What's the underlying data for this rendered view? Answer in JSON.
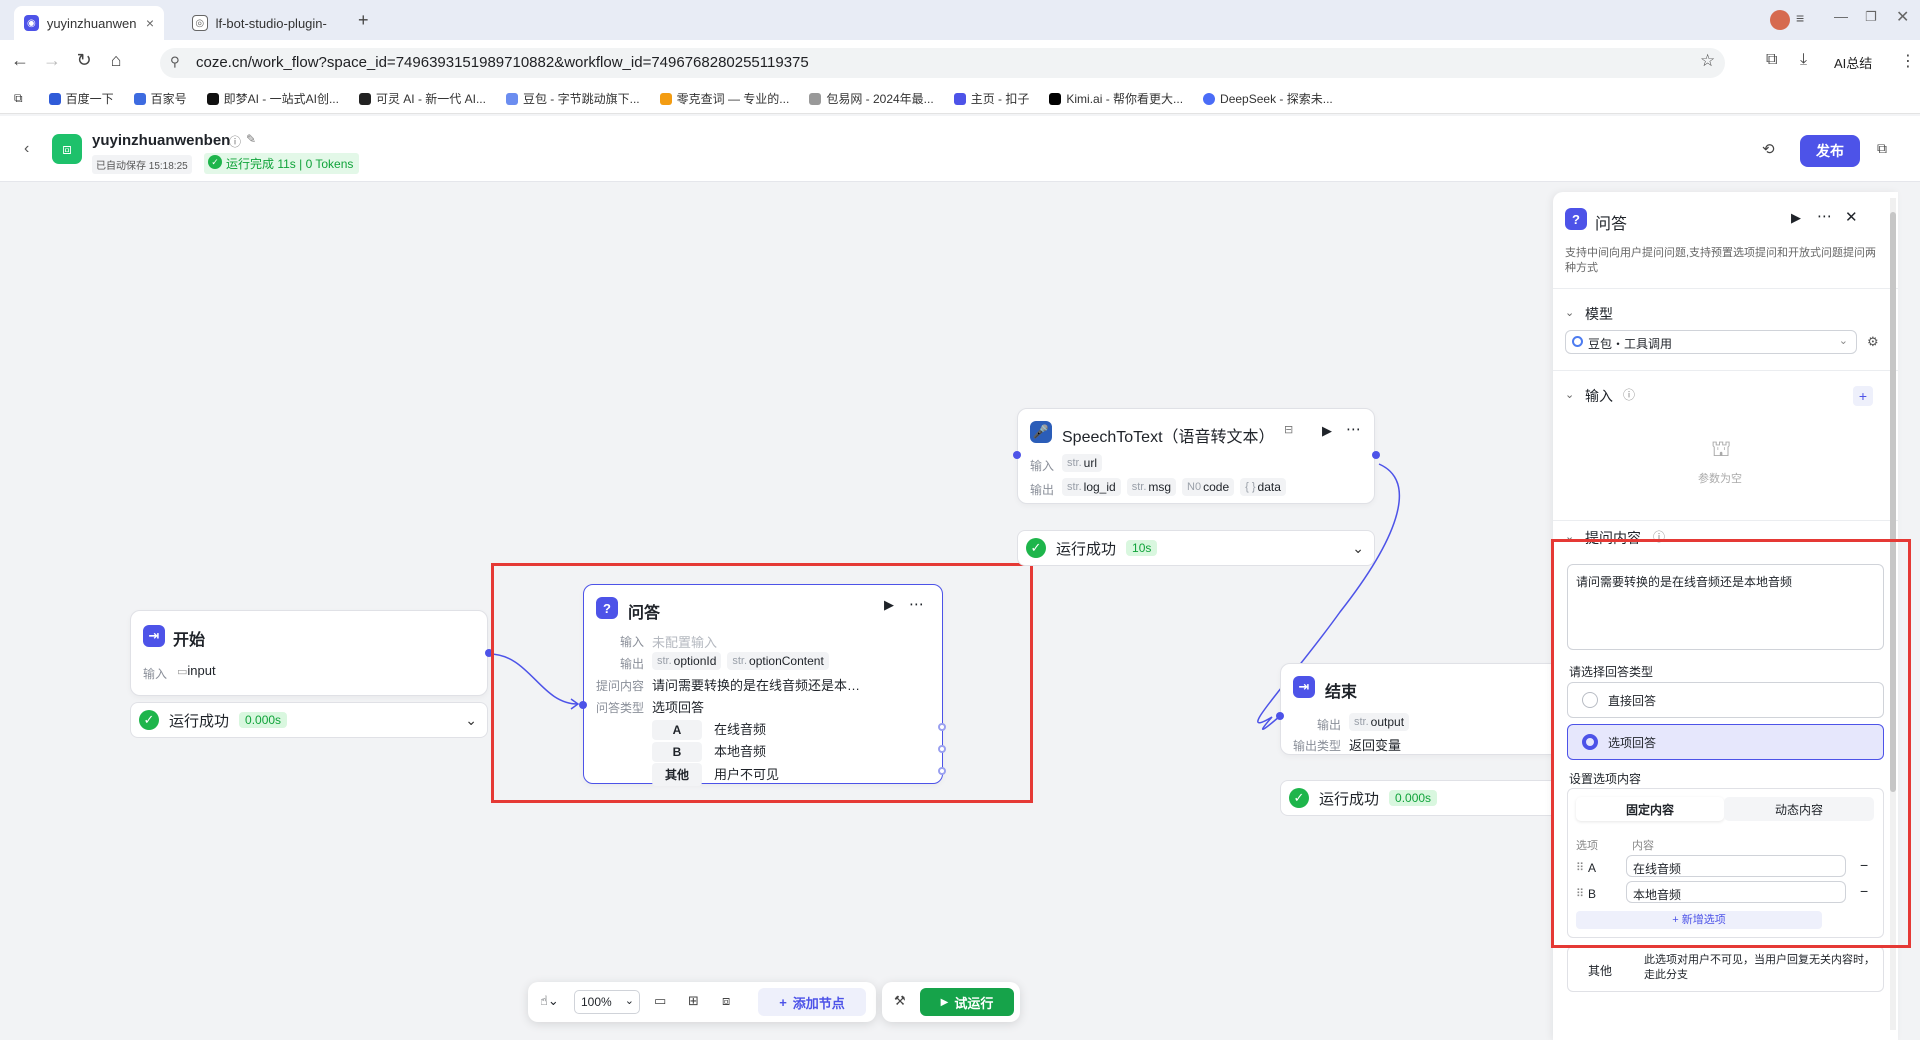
{
  "browser": {
    "tabs": [
      {
        "label": "yuyinzhuanwenb",
        "active": true
      },
      {
        "label": "lf-bot-studio-plugin-",
        "active": false
      }
    ],
    "new_tab": "+",
    "url": "coze.cn/work_flow?space_id=7496393151989710882&workflow_id=7496768280255119375",
    "ai_label": "AI总结",
    "bookmarks": [
      "百度一下",
      "百家号",
      "即梦AI - 一站式AI创...",
      "可灵 AI - 新一代 AI...",
      "豆包 - 字节跳动旗下...",
      "零克查词 — 专业的...",
      "包易网 - 2024年最...",
      "主页 - 扣子",
      "Kimi.ai - 帮你看更大...",
      "DeepSeek - 探索未..."
    ]
  },
  "header": {
    "title": "yuyinzhuanwenben",
    "autosave": "已自动保存 15:18:25",
    "run_status": "运行完成 11s | 0 Tokens",
    "publish": "发布"
  },
  "nodes": {
    "start": {
      "title": "开始",
      "input_label": "输入",
      "input_value": "input",
      "status": "运行成功",
      "time": "0.000s"
    },
    "qa": {
      "title": "问答",
      "input_label": "输入",
      "input_value": "未配置输入",
      "output_label": "输出",
      "outputs": [
        {
          "type": "str.",
          "name": "optionId"
        },
        {
          "type": "str.",
          "name": "optionContent"
        }
      ],
      "question_label": "提问内容",
      "question_value": "请问需要转换的是在线音频还是本…",
      "type_label": "问答类型",
      "type_value": "选项回答",
      "options": [
        {
          "key": "A",
          "value": "在线音频"
        },
        {
          "key": "B",
          "value": "本地音频"
        },
        {
          "key": "其他",
          "value": "用户不可见"
        }
      ]
    },
    "speech": {
      "title": "SpeechToText（语音转文本）",
      "input_label": "输入",
      "input_type": "str.",
      "input_value": "url",
      "output_label": "输出",
      "outputs": [
        {
          "type": "str.",
          "name": "log_id"
        },
        {
          "type": "str.",
          "name": "msg"
        },
        {
          "type": "N0",
          "name": "code"
        },
        {
          "type": "{ }",
          "name": "data"
        }
      ],
      "status": "运行成功",
      "time": "10s"
    },
    "end": {
      "title": "结束",
      "output_label": "输出",
      "output_type": "str.",
      "output_value": "output",
      "type_label": "输出类型",
      "type_value": "返回变量",
      "status": "运行成功",
      "time": "0.000s"
    }
  },
  "panel": {
    "title": "问答",
    "description": "支持中间向用户提问问题,支持预置选项提问和开放式问题提问两种方式",
    "model_section": "模型",
    "model_value": "豆包・工具调用",
    "input_section": "输入",
    "input_empty": "参数为空",
    "question_section": "提问内容",
    "question_text": "请问需要转换的是在线音频还是本地音频",
    "answer_type_label": "请选择回答类型",
    "answer_types": [
      {
        "label": "直接回答",
        "selected": false
      },
      {
        "label": "选项回答",
        "selected": true
      }
    ],
    "options_label": "设置选项内容",
    "tabs": [
      "固定内容",
      "动态内容"
    ],
    "col_option": "选项",
    "col_content": "内容",
    "options": [
      {
        "key": "A",
        "value": "在线音频"
      },
      {
        "key": "B",
        "value": "本地音频"
      }
    ],
    "add_option": "+ 新增选项",
    "other_key": "其他",
    "other_desc": "此选项对用户不可见，当用户回复无关内容时，走此分支"
  },
  "toolbar": {
    "zoom": "100%",
    "add_node": "添加节点",
    "test_run": "试运行"
  },
  "colors": {
    "brand": "#4d53e8",
    "success": "#1eb54b",
    "highlight": "#e53935"
  }
}
